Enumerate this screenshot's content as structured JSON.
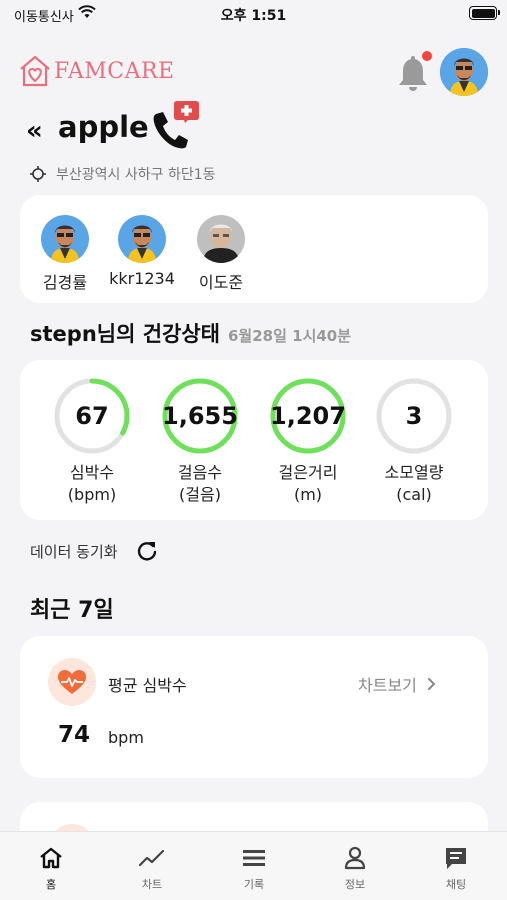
{
  "status_bar": {
    "carrier": "이동통신사",
    "time": "오후 1:51"
  },
  "header": {
    "logo_text": "FAMCARE"
  },
  "profile": {
    "back_label": "«",
    "name": "apple",
    "address": "부산광역시 사하구 하단1동"
  },
  "members": [
    {
      "name": "김경률",
      "avatar": "cartoon-avatar-icon"
    },
    {
      "name": "kkr1234",
      "avatar": "cartoon-avatar-icon"
    },
    {
      "name": "이도준",
      "avatar": "photo-avatar"
    }
  ],
  "health": {
    "title": "stepn님의 건강상태",
    "datetime": "6월28일 1시40분",
    "stats": [
      {
        "value": "67",
        "label": "심박수",
        "unit": "(bpm)",
        "progress": 0.33
      },
      {
        "value": "1,655",
        "label": "걸음수",
        "unit": "(걸음)",
        "progress": 1.0
      },
      {
        "value": "1,207",
        "label": "걸은거리",
        "unit": "(m)",
        "progress": 1.0
      },
      {
        "value": "3",
        "label": "소모열량",
        "unit": "(cal)",
        "progress": 0.0
      }
    ]
  },
  "sync": {
    "label": "데이터 동기화"
  },
  "recent": {
    "title": "최근 7일",
    "heart_card": {
      "title": "평균 심박수",
      "chart_link": "차트보기",
      "value": "74",
      "unit": "bpm"
    }
  },
  "tabs": [
    {
      "label": "홈",
      "icon": "home-icon",
      "active": true
    },
    {
      "label": "차트",
      "icon": "chart-icon",
      "active": false
    },
    {
      "label": "기록",
      "icon": "list-icon",
      "active": false
    },
    {
      "label": "정보",
      "icon": "person-icon",
      "active": false
    },
    {
      "label": "채팅",
      "icon": "chat-icon",
      "active": false
    }
  ],
  "colors": {
    "accent": "#e8707e",
    "progress": "#6ee05a",
    "track": "#e2e2e2",
    "heart": "#f26b3a"
  }
}
